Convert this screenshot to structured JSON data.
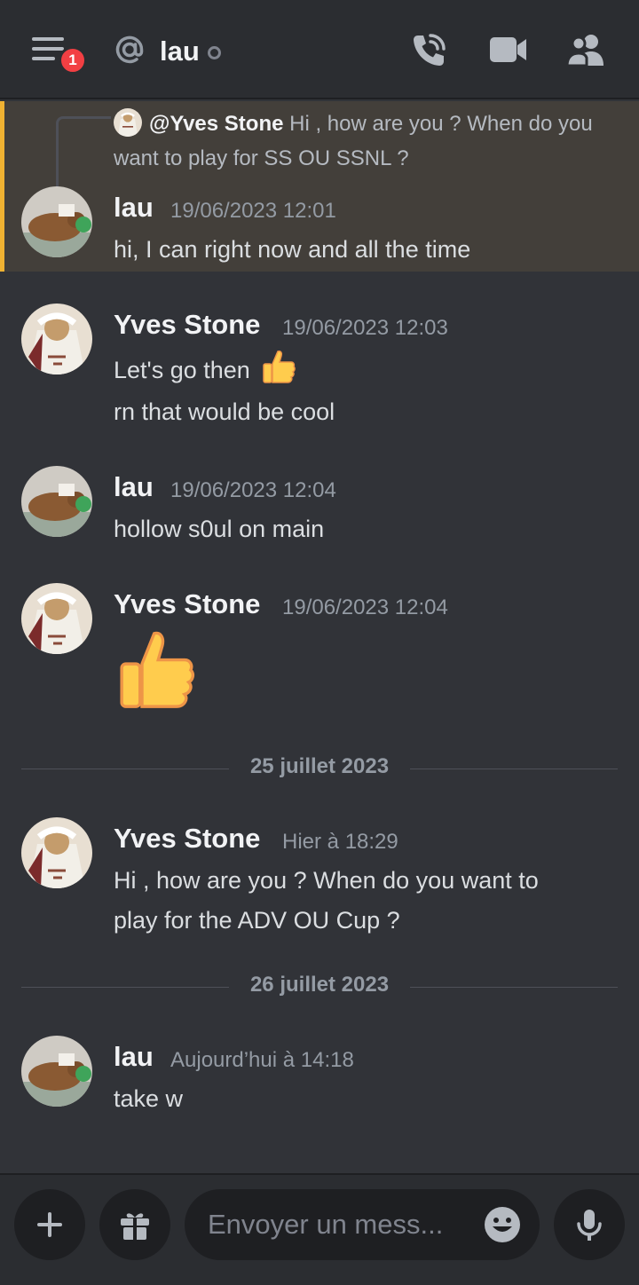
{
  "header": {
    "menu_badge": "1",
    "channel_title": "lau",
    "icons": [
      "menu-icon",
      "at-icon",
      "phone-call-icon",
      "video-camera-icon",
      "members-icon"
    ]
  },
  "reply": {
    "mention": "@Yves Stone",
    "text": "Hi , how are you ?  When do you want to play for SS OU SSNL ?"
  },
  "messages": [
    {
      "author": "lau",
      "time": "19/06/2023 12:01",
      "lines": [
        "hi, I can right now and all the time"
      ]
    },
    {
      "author": "Yves Stone",
      "time": "19/06/2023 12:03",
      "lines": [
        "Let's go then",
        "rn that would be cool"
      ]
    },
    {
      "author": "lau",
      "time": "19/06/2023 12:04",
      "lines": [
        "hollow s0ul on main"
      ]
    },
    {
      "author": "Yves Stone",
      "time": "19/06/2023 12:04",
      "lines": []
    },
    {
      "author": "Yves Stone",
      "time": "Hier à 18:29",
      "lines": [
        "Hi , how are you ? When do you want to",
        "play for the ADV OU Cup ?"
      ]
    },
    {
      "author": "lau",
      "time": "Aujourd’hui à 14:18",
      "lines": [
        "take w"
      ]
    }
  ],
  "dividers": [
    "25 juillet 2023",
    "26 juillet 2023"
  ],
  "composer": {
    "placeholder": "Envoyer un mess..."
  },
  "colors": {
    "background": "#313338",
    "header": "#2b2d31",
    "highlight": "#433f3a",
    "highlight_border": "#f0b232",
    "badge": "#f23f43"
  }
}
